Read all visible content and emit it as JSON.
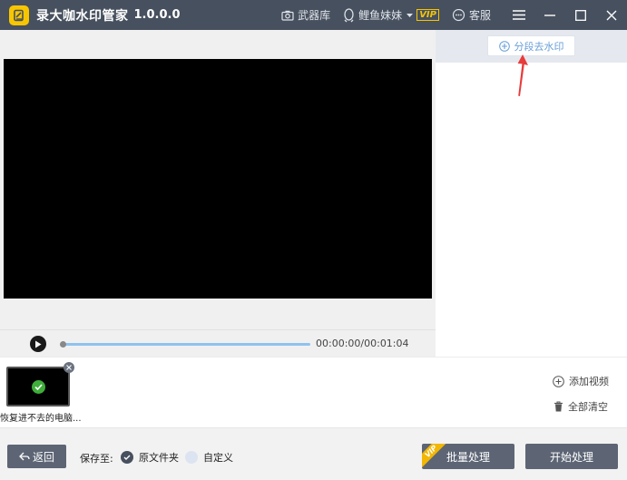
{
  "app": {
    "title": "录大咖水印管家",
    "version": "1.0.0.0",
    "logo_icon": "pencil-logo-icon"
  },
  "titlebar": {
    "arsenal_label": "武器库",
    "user_name": "鲤鱼妹妹",
    "vip_label": "VIP",
    "service_label": "客服"
  },
  "player": {
    "time_display": "00:00:00/00:01:04",
    "progress": 0.0
  },
  "right_panel": {
    "segment_button_label": "分段去水印"
  },
  "file_list": {
    "items": [
      {
        "name": "恢复进不去的电脑...",
        "status": "done"
      }
    ],
    "add_video_label": "添加视频",
    "clear_all_label": "全部清空"
  },
  "bottom": {
    "back_label": "返回",
    "save_to_label": "保存至:",
    "option_original": "原文件夹",
    "option_custom": "自定义",
    "selected_option": "原文件夹",
    "batch_label": "批量处理",
    "batch_badge": "VIP",
    "start_label": "开始处理"
  },
  "colors": {
    "titlebar": "#47505e",
    "accent_blue": "#6a9fd8",
    "button_dark": "#5d6575",
    "vip_gold": "#f2b705",
    "annotation_red": "#e83b3b"
  }
}
